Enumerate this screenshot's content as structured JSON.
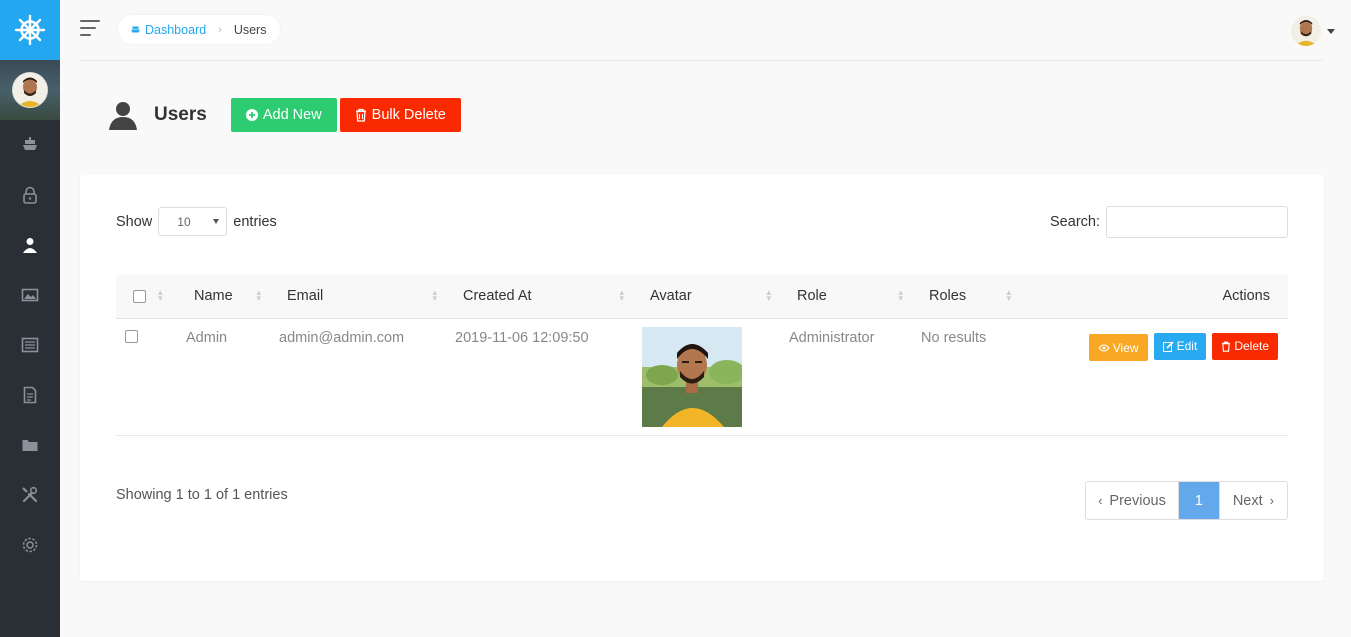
{
  "breadcrumb": {
    "root": "Dashboard",
    "current": "Users"
  },
  "page": {
    "title": "Users",
    "add_label": "Add New",
    "bulk_delete_label": "Bulk Delete"
  },
  "table_controls": {
    "show_label": "Show",
    "page_size": "10",
    "entries_label": "entries",
    "search_label": "Search:"
  },
  "table": {
    "headers": {
      "name": "Name",
      "email": "Email",
      "created_at": "Created At",
      "avatar": "Avatar",
      "role": "Role",
      "roles": "Roles",
      "actions": "Actions"
    },
    "rows": [
      {
        "name": "Admin",
        "email": "admin@admin.com",
        "created_at": "2019-11-06 12:09:50",
        "role": "Administrator",
        "roles": "No results"
      }
    ],
    "action_labels": {
      "view": "View",
      "edit": "Edit",
      "delete": "Delete"
    }
  },
  "footer": {
    "info": "Showing 1 to 1 of 1 entries",
    "previous": "Previous",
    "current_page": "1",
    "next": "Next"
  },
  "colors": {
    "brand": "#22a7f0",
    "sidebar": "#2a2f36",
    "success": "#2ecc71",
    "danger": "#fa2a00",
    "warning": "#f9a825",
    "info": "#29a9f0",
    "page_active": "#62a8ea"
  }
}
